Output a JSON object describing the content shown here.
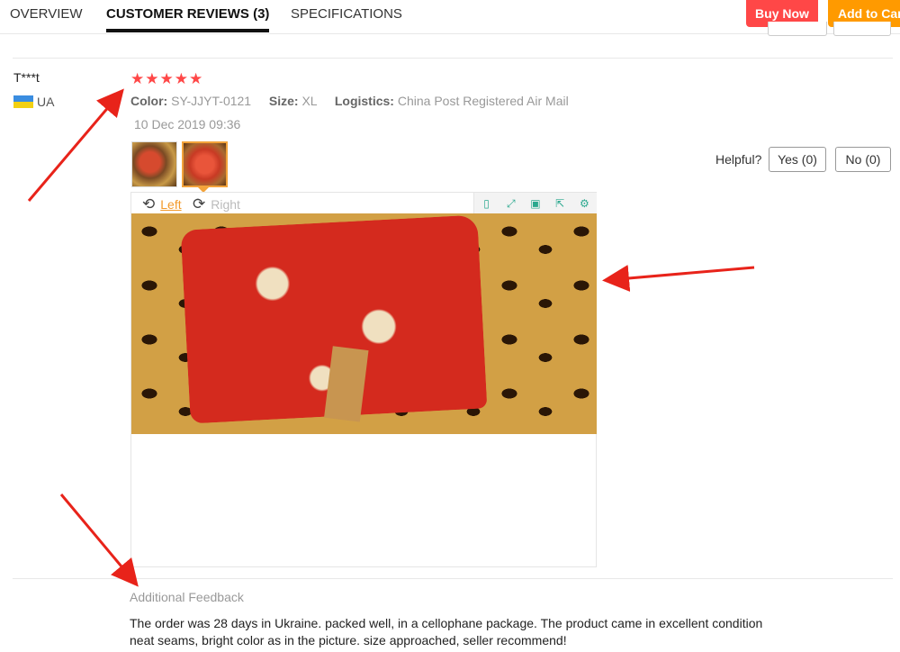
{
  "tabs": [
    {
      "label": "OVERVIEW",
      "active": false
    },
    {
      "label": "CUSTOMER REVIEWS (3)",
      "active": true
    },
    {
      "label": "SPECIFICATIONS",
      "active": false
    }
  ],
  "actions": {
    "buy_now": "Buy Now",
    "add_to_cart": "Add to Cart"
  },
  "review": {
    "reviewer": "T***t",
    "country": "UA",
    "rating": 5,
    "stars": [
      "★",
      "★",
      "★",
      "★",
      "★"
    ],
    "color_label": "Color:",
    "color_value": "SY-JJYT-0121",
    "size_label": "Size:",
    "size_value": "XL",
    "logistics_label": "Logistics:",
    "logistics_value": "China Post Registered Air Mail",
    "date": "10 Dec 2019 09:36",
    "helpful_label": "Helpful?",
    "yes_label": "Yes (0)",
    "no_label": "No (0)",
    "viewer": {
      "rotate_left": "Left",
      "rotate_right": "Right",
      "rotate_left_icon": "rotate-ccw-icon",
      "rotate_right_icon": "rotate-cw-icon",
      "tools": [
        "page-icon",
        "fullscreen-icon",
        "save-icon",
        "share-icon",
        "settings-icon"
      ]
    },
    "additional_feedback_title": "Additional Feedback",
    "additional_feedback_text": "The order was 28 days in Ukraine. packed well, in a cellophane package. The product came in excellent condition neat seams, bright color as in the picture. size approached, seller recommend!"
  },
  "colors": {
    "accent_red": "#ff4747",
    "accent_orange": "#ff9a00",
    "link_orange": "#f39a2b",
    "annotation_red": "#e8231a"
  }
}
